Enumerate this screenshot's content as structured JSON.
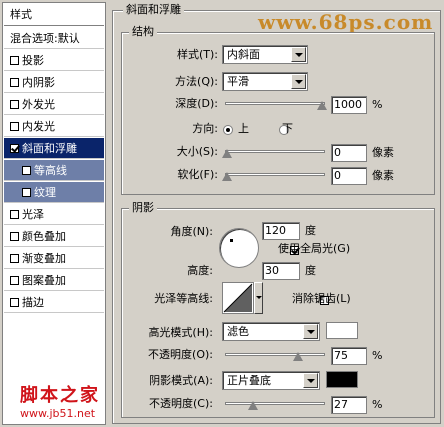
{
  "watermark_top": "www.68ps.com",
  "watermark_bottom": {
    "brand": "脚本之家",
    "url": "www.jb51.net"
  },
  "sidebar": {
    "header": "样式",
    "items": [
      {
        "label": "混合选项:默认",
        "checkbox": false,
        "checked": false,
        "state": "normal"
      },
      {
        "label": "投影",
        "checkbox": true,
        "checked": false,
        "state": "normal"
      },
      {
        "label": "内阴影",
        "checkbox": true,
        "checked": false,
        "state": "normal"
      },
      {
        "label": "外发光",
        "checkbox": true,
        "checked": false,
        "state": "normal"
      },
      {
        "label": "内发光",
        "checkbox": true,
        "checked": false,
        "state": "normal"
      },
      {
        "label": "斜面和浮雕",
        "checkbox": true,
        "checked": true,
        "state": "selected"
      },
      {
        "label": "等高线",
        "checkbox": true,
        "checked": false,
        "state": "sub"
      },
      {
        "label": "纹理",
        "checkbox": true,
        "checked": false,
        "state": "sub"
      },
      {
        "label": "光泽",
        "checkbox": true,
        "checked": false,
        "state": "normal"
      },
      {
        "label": "颜色叠加",
        "checkbox": true,
        "checked": false,
        "state": "normal"
      },
      {
        "label": "渐变叠加",
        "checkbox": true,
        "checked": false,
        "state": "normal"
      },
      {
        "label": "图案叠加",
        "checkbox": true,
        "checked": false,
        "state": "normal"
      },
      {
        "label": "描边",
        "checkbox": true,
        "checked": false,
        "state": "normal"
      }
    ]
  },
  "panel": {
    "title": "斜面和浮雕"
  },
  "structure": {
    "title": "结构",
    "style_label": "样式(T):",
    "style_value": "内斜面",
    "technique_label": "方法(Q):",
    "technique_value": "平滑",
    "depth_label": "深度(D):",
    "depth_value": "1000",
    "depth_unit": "%",
    "depth_level": 1.0,
    "direction_label": "方向:",
    "dir_up": "上",
    "dir_down": "下",
    "direction_selected": "up",
    "size_label": "大小(S):",
    "size_value": "0",
    "size_unit": "像素",
    "size_level": 0,
    "soften_label": "软化(F):",
    "soften_value": "0",
    "soften_unit": "像素",
    "soften_level": 0
  },
  "shading": {
    "title": "阴影",
    "angle_label": "角度(N):",
    "angle_value": "120",
    "angle_unit": "度",
    "global_light_label": "使用全局光(G)",
    "global_light_checked": true,
    "altitude_label": "高度:",
    "altitude_value": "30",
    "altitude_unit": "度",
    "gloss_label": "光泽等高线:",
    "antialias_label": "消除锯齿(L)",
    "antialias_checked": false,
    "highlight_label": "高光模式(H):",
    "highlight_value": "滤色",
    "highlight_color": "#ffffff",
    "hl_opacity_label": "不透明度(O):",
    "hl_opacity_value": "75",
    "hl_opacity_unit": "%",
    "hl_opacity_level": 0.75,
    "shadow_label": "阴影模式(A):",
    "shadow_value": "正片叠底",
    "shadow_color": "#000000",
    "sh_opacity_label": "不透明度(C):",
    "sh_opacity_value": "27",
    "sh_opacity_unit": "%",
    "sh_opacity_level": 0.27
  }
}
